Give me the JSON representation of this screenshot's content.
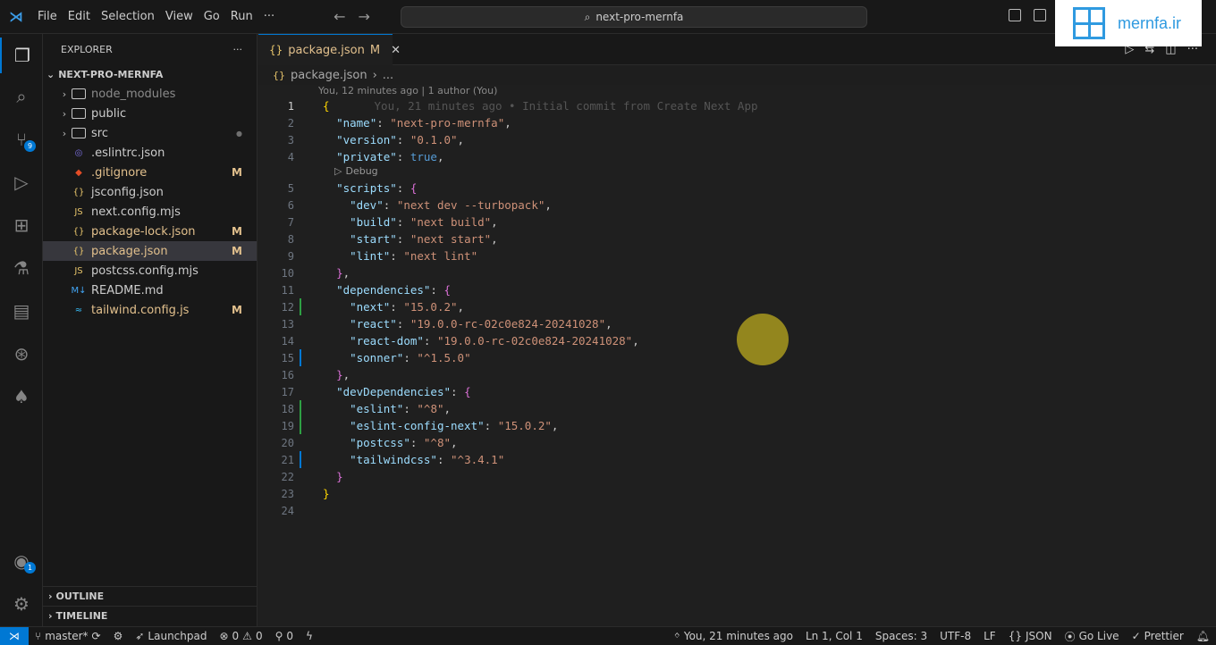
{
  "titlebar": {
    "menu": [
      "File",
      "Edit",
      "Selection",
      "View",
      "Go",
      "Run",
      "···"
    ],
    "search": "next-pro-mernfa",
    "brand": "mernfa.ir"
  },
  "activity": {
    "scm_badge": "9",
    "account_badge": "1"
  },
  "sidebar": {
    "title": "EXPLORER",
    "more": "···",
    "folder": "NEXT-PRO-MERNFA",
    "items": [
      {
        "label": "node_modules",
        "type": "folder",
        "mark": "",
        "color": "#8b8b8b"
      },
      {
        "label": "public",
        "type": "folder",
        "mark": "",
        "color": "#cccccc"
      },
      {
        "label": "src",
        "type": "folder",
        "mark": "●",
        "color": "#cccccc"
      },
      {
        "label": ".eslintrc.json",
        "type": "eslint",
        "mark": "",
        "color": "#cccccc"
      },
      {
        "label": ".gitignore",
        "type": "git",
        "mark": "M",
        "color": "#e2c08d"
      },
      {
        "label": "jsconfig.json",
        "type": "json",
        "mark": "",
        "color": "#cccccc"
      },
      {
        "label": "next.config.mjs",
        "type": "js",
        "mark": "",
        "color": "#cccccc"
      },
      {
        "label": "package-lock.json",
        "type": "json",
        "mark": "M",
        "color": "#e2c08d"
      },
      {
        "label": "package.json",
        "type": "json",
        "mark": "M",
        "color": "#e2c08d"
      },
      {
        "label": "postcss.config.mjs",
        "type": "js",
        "mark": "",
        "color": "#cccccc"
      },
      {
        "label": "README.md",
        "type": "md",
        "mark": "",
        "color": "#cccccc"
      },
      {
        "label": "tailwind.config.js",
        "type": "tw",
        "mark": "M",
        "color": "#e2c08d"
      }
    ],
    "outline": "OUTLINE",
    "timeline": "TIMELINE"
  },
  "editor": {
    "tab_label": "package.json",
    "tab_mark": "M",
    "breadcrumb_file": "package.json",
    "breadcrumb_more": "...",
    "blame_header": "You, 12 minutes ago | 1 author (You)",
    "inline_blame": "You, 21 minutes ago • Initial commit from Create Next App",
    "codelens": "Debug",
    "current_line": 1
  },
  "statusbar": {
    "branch": "master*",
    "launchpad": "Launchpad",
    "errors": "0",
    "warnings": "0",
    "ports": "0",
    "blame": "You, 21 minutes ago",
    "position": "Ln 1, Col 1",
    "spaces": "Spaces: 3",
    "encoding": "UTF-8",
    "eol": "LF",
    "language": "JSON",
    "golive": "Go Live",
    "prettier": "Prettier"
  }
}
